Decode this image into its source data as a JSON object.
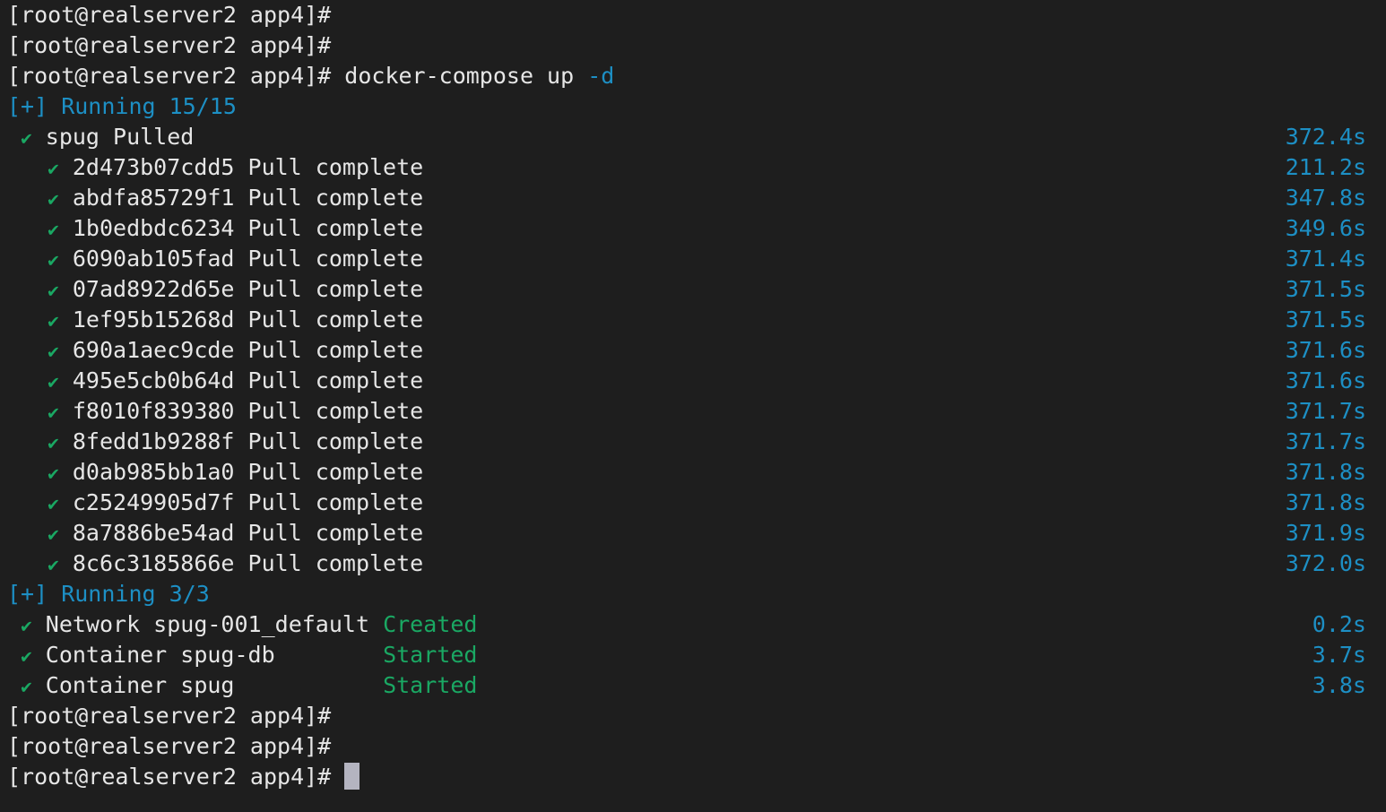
{
  "terminal": {
    "background_color": "#1e1e1e",
    "text_color": "#e6e6e6",
    "accent_blue": "#1d8fc4",
    "accent_green": "#1aa863",
    "cursor_color": "#b4b4c0",
    "prompt": "[root@realserver2 app4]#",
    "command": "docker-compose up -d",
    "command_base": "docker-compose up",
    "command_flag": "-d",
    "check_glyph": "✔",
    "lines": [
      {
        "type": "prompt",
        "prompt": "[root@realserver2 app4]#",
        "command": ""
      },
      {
        "type": "prompt",
        "prompt": "[root@realserver2 app4]#",
        "command": ""
      },
      {
        "type": "prompt-cmd",
        "prompt": "[root@realserver2 app4]#",
        "command": " docker-compose up",
        "flag": " -d"
      },
      {
        "type": "running",
        "text": "[+] Running 15/15"
      },
      {
        "type": "task",
        "indent": 1,
        "label": "spug Pulled",
        "time": "372.4s"
      },
      {
        "type": "task",
        "indent": 2,
        "label": "2d473b07cdd5 Pull complete",
        "time": "211.2s"
      },
      {
        "type": "task",
        "indent": 2,
        "label": "abdfa85729f1 Pull complete",
        "time": "347.8s"
      },
      {
        "type": "task",
        "indent": 2,
        "label": "1b0edbdc6234 Pull complete",
        "time": "349.6s"
      },
      {
        "type": "task",
        "indent": 2,
        "label": "6090ab105fad Pull complete",
        "time": "371.4s"
      },
      {
        "type": "task",
        "indent": 2,
        "label": "07ad8922d65e Pull complete",
        "time": "371.5s"
      },
      {
        "type": "task",
        "indent": 2,
        "label": "1ef95b15268d Pull complete",
        "time": "371.5s"
      },
      {
        "type": "task",
        "indent": 2,
        "label": "690a1aec9cde Pull complete",
        "time": "371.6s"
      },
      {
        "type": "task",
        "indent": 2,
        "label": "495e5cb0b64d Pull complete",
        "time": "371.6s"
      },
      {
        "type": "task",
        "indent": 2,
        "label": "f8010f839380 Pull complete",
        "time": "371.7s"
      },
      {
        "type": "task",
        "indent": 2,
        "label": "8fedd1b9288f Pull complete",
        "time": "371.7s"
      },
      {
        "type": "task",
        "indent": 2,
        "label": "d0ab985bb1a0 Pull complete",
        "time": "371.8s"
      },
      {
        "type": "task",
        "indent": 2,
        "label": "c25249905d7f Pull complete",
        "time": "371.8s"
      },
      {
        "type": "task",
        "indent": 2,
        "label": "8a7886be54ad Pull complete",
        "time": "371.9s"
      },
      {
        "type": "task",
        "indent": 2,
        "label": "8c6c3185866e Pull complete",
        "time": "372.0s"
      },
      {
        "type": "running",
        "text": "[+] Running 3/3"
      },
      {
        "type": "resource",
        "indent": 1,
        "label": "Network spug-001_default",
        "status": "Created",
        "time": "0.2s"
      },
      {
        "type": "resource",
        "indent": 1,
        "label": "Container spug-db",
        "status": "Started",
        "time": "3.7s"
      },
      {
        "type": "resource",
        "indent": 1,
        "label": "Container spug",
        "status": "Started",
        "time": "3.8s"
      },
      {
        "type": "prompt",
        "prompt": "[root@realserver2 app4]#",
        "command": ""
      },
      {
        "type": "prompt",
        "prompt": "[root@realserver2 app4]#",
        "command": ""
      },
      {
        "type": "prompt-cursor",
        "prompt": "[root@realserver2 app4]#",
        "command": " "
      }
    ]
  }
}
